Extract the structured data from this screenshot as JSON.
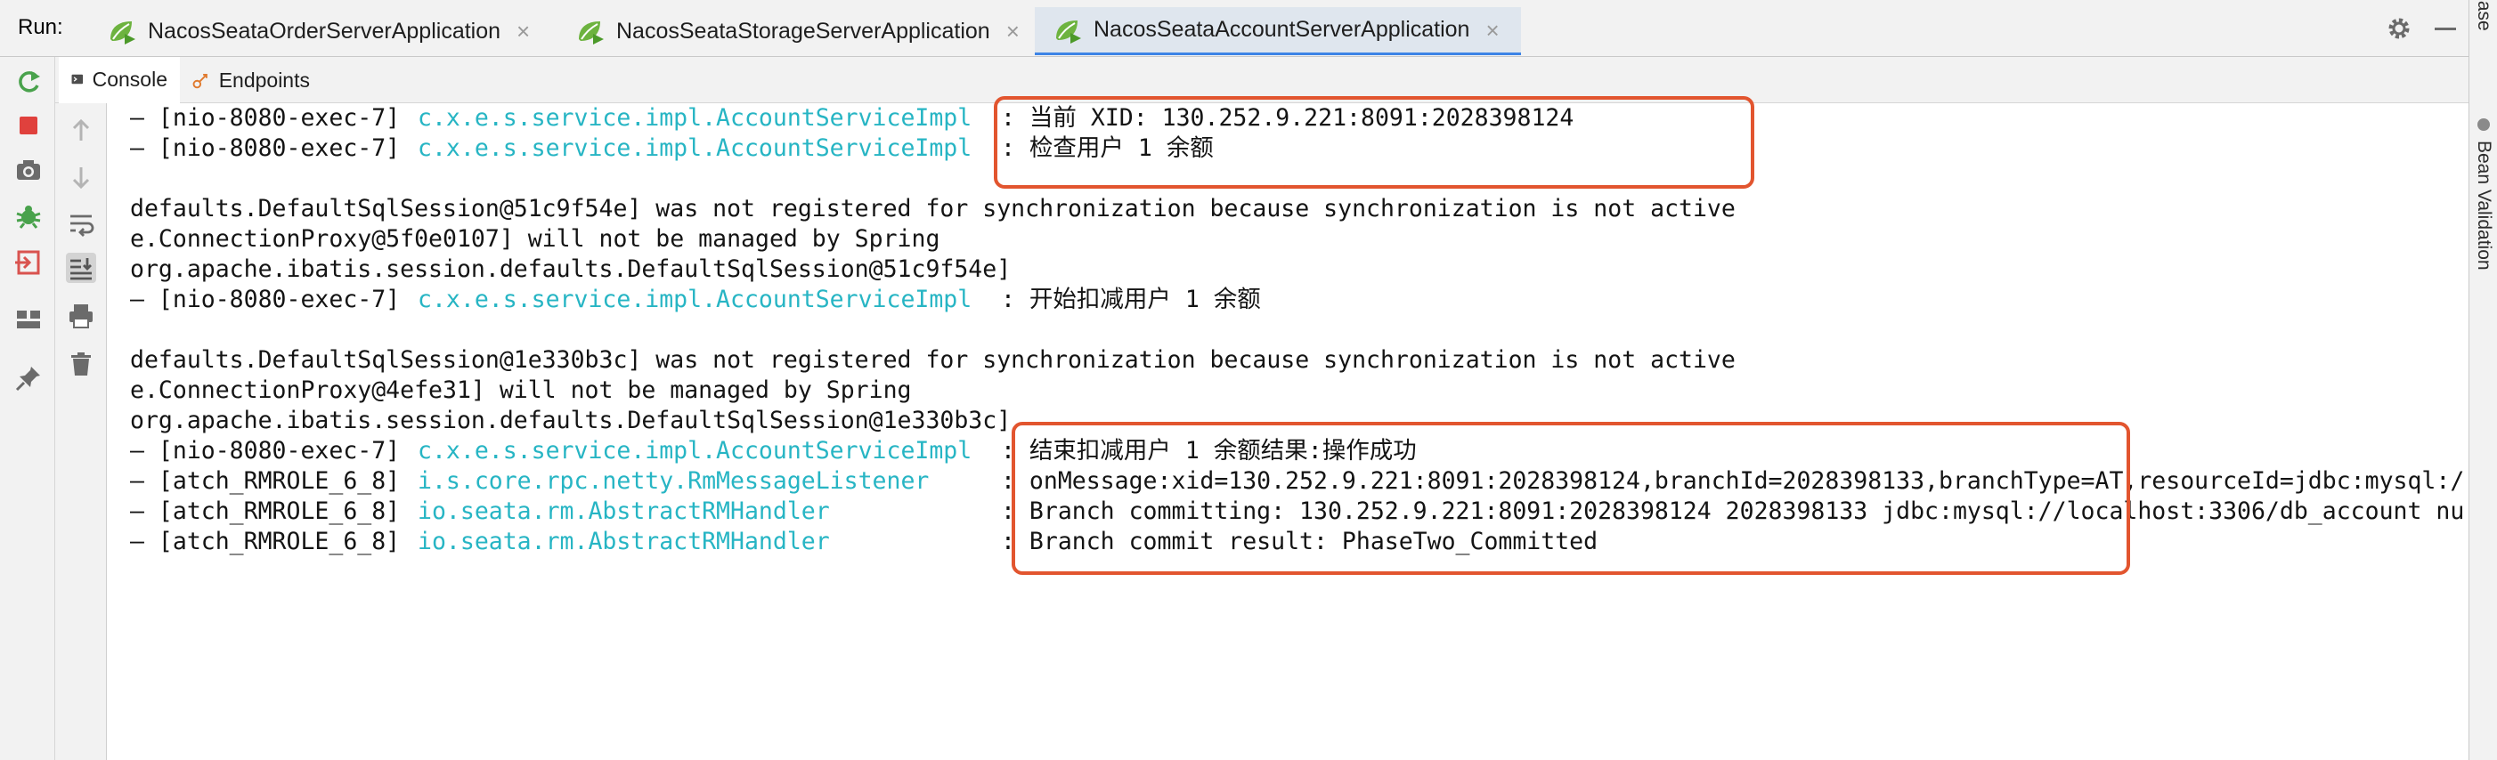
{
  "run_bar": {
    "label": "Run:",
    "tabs": [
      {
        "label": "NacosSeataOrderServerApplication",
        "active": false
      },
      {
        "label": "NacosSeataStorageServerApplication",
        "active": false
      },
      {
        "label": "NacosSeataAccountServerApplication",
        "active": true
      }
    ],
    "close_glyph": "×"
  },
  "right_strip": {
    "items": [
      "atabase",
      "Bean Validation"
    ]
  },
  "subtabs": [
    {
      "label": "Console",
      "icon": "console-icon",
      "active": true
    },
    {
      "label": "Endpoints",
      "icon": "endpoints-icon",
      "active": false
    }
  ],
  "left_tools": [
    "rerun-icon",
    "stop-icon",
    "camera-icon",
    "debug-icon",
    "exit-icon",
    "layout-icon",
    "pin-icon"
  ],
  "gutter_tools": [
    "up-arrow-icon",
    "down-arrow-icon",
    "soft-wrap-icon",
    "scroll-to-end-icon",
    "print-icon",
    "trash-icon"
  ],
  "console_lines": [
    {
      "prefix": "— [nio-8080-exec-7]",
      "logger": "c.x.e.s.service.impl.AccountServiceImpl",
      "message": ": 当前 XID: 130.252.9.221:8091:2028398124"
    },
    {
      "prefix": "— [nio-8080-exec-7]",
      "logger": "c.x.e.s.service.impl.AccountServiceImpl",
      "message": ": 检查用户 1 余额"
    },
    {
      "text": ""
    },
    {
      "text": "defaults.DefaultSqlSession@51c9f54e] was not registered for synchronization because synchronization is not active"
    },
    {
      "text": "e.ConnectionProxy@5f0e0107] will not be managed by Spring"
    },
    {
      "text": "org.apache.ibatis.session.defaults.DefaultSqlSession@51c9f54e]"
    },
    {
      "prefix": "— [nio-8080-exec-7]",
      "logger": "c.x.e.s.service.impl.AccountServiceImpl",
      "message": ": 开始扣减用户 1 余额"
    },
    {
      "text": ""
    },
    {
      "text": "defaults.DefaultSqlSession@1e330b3c] was not registered for synchronization because synchronization is not active"
    },
    {
      "text": "e.ConnectionProxy@4efe31] will not be managed by Spring"
    },
    {
      "text": "org.apache.ibatis.session.defaults.DefaultSqlSession@1e330b3c]"
    },
    {
      "prefix": "— [nio-8080-exec-7]",
      "logger": "c.x.e.s.service.impl.AccountServiceImpl",
      "message": ": 结束扣减用户 1 余额结果:操作成功"
    },
    {
      "prefix": "— [atch_RMROLE_6_8]",
      "logger": "i.s.core.rpc.netty.RmMessageListener",
      "message": ": onMessage:xid=130.252.9.221:8091:2028398124,branchId=2028398133,branchType=AT,resourceId=jdbc:mysql:/"
    },
    {
      "prefix": "— [atch_RMROLE_6_8]",
      "logger": "io.seata.rm.AbstractRMHandler",
      "message": ": Branch committing: 130.252.9.221:8091:2028398124 2028398133 jdbc:mysql://localhost:3306/db_account nu"
    },
    {
      "prefix": "— [atch_RMROLE_6_8]",
      "logger": "io.seata.rm.AbstractRMHandler",
      "message": ": Branch commit result: PhaseTwo_Committed"
    }
  ],
  "colors": {
    "logger": "#27b5c4",
    "highlight": "#e2552f",
    "active_tab_underline": "#3d84e6"
  }
}
